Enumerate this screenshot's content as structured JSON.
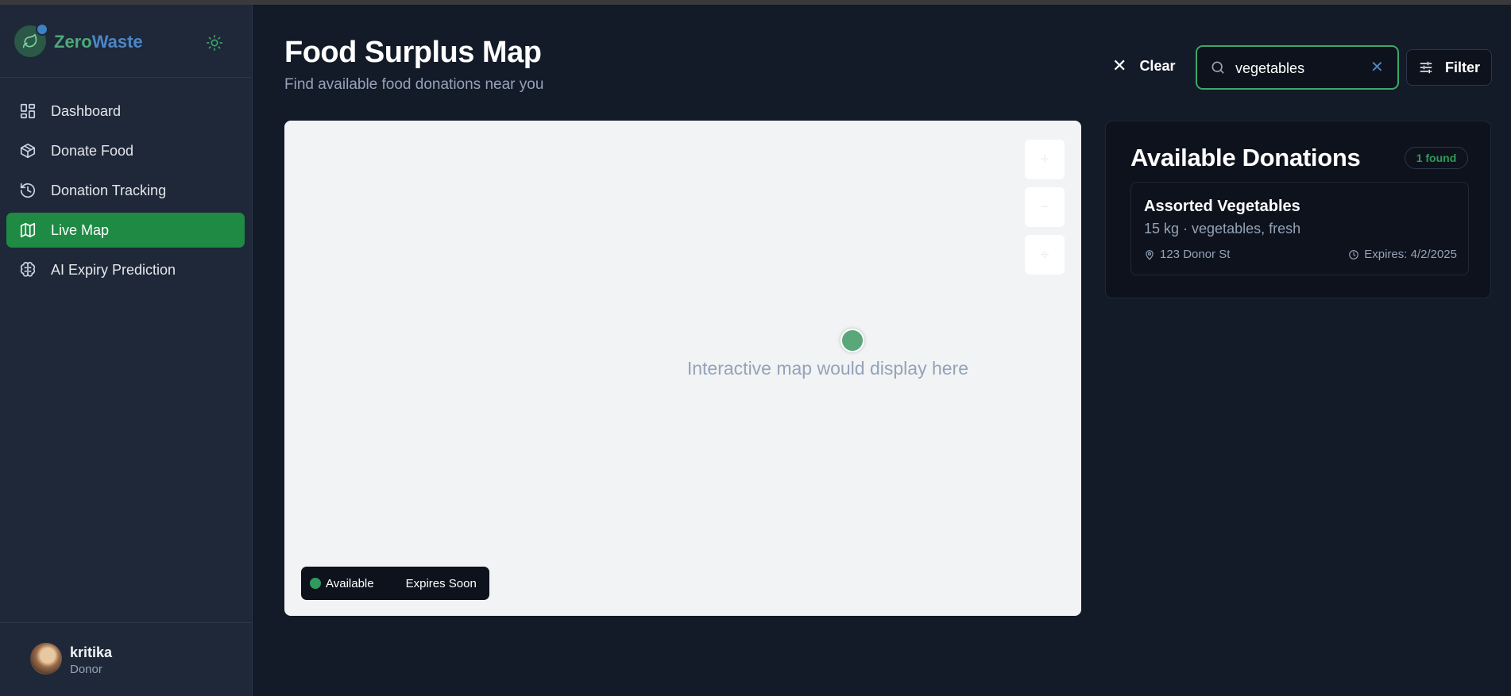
{
  "brand": {
    "name_part1": "Zero",
    "name_part2": "Waste"
  },
  "sidebar": {
    "items": [
      {
        "label": "Dashboard",
        "icon": "dashboard-icon",
        "active": false
      },
      {
        "label": "Donate Food",
        "icon": "package-icon",
        "active": false
      },
      {
        "label": "Donation Tracking",
        "icon": "history-icon",
        "active": false
      },
      {
        "label": "Live Map",
        "icon": "map-icon",
        "active": true
      },
      {
        "label": "AI Expiry Prediction",
        "icon": "brain-icon",
        "active": false
      }
    ]
  },
  "user": {
    "name": "kritika",
    "role": "Donor"
  },
  "header": {
    "title": "Food Surplus Map",
    "subtitle": "Find available food donations near you",
    "clear_label": "Clear",
    "search_value": "vegetables",
    "filter_label": "Filter"
  },
  "map": {
    "placeholder": "Interactive map would display here",
    "zoom_in": "+",
    "zoom_out": "−",
    "locate": "⌖",
    "legend": {
      "available": "Available",
      "expires_soon": "Expires Soon"
    }
  },
  "donations": {
    "title": "Available Donations",
    "count_badge": "1 found",
    "items": [
      {
        "title": "Assorted Vegetables",
        "meta": "15 kg · vegetables, fresh",
        "location": "123 Donor St",
        "expires": "Expires: 4/2/2025"
      }
    ]
  },
  "colors": {
    "accent": "#1e8a43",
    "brand_green": "#4ea97a",
    "brand_blue": "#4b86c8",
    "background": "#131a28"
  }
}
